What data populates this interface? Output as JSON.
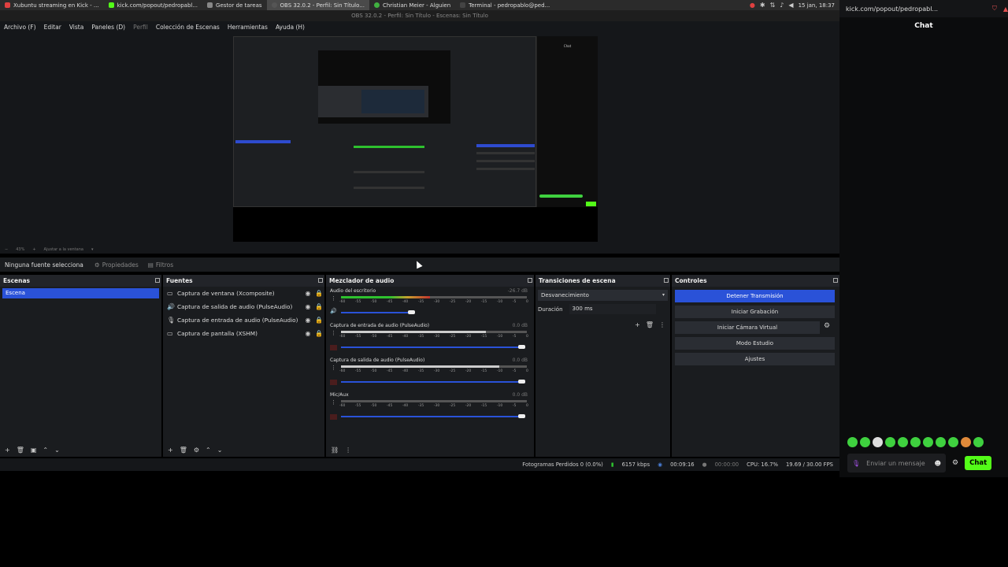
{
  "topbar": {
    "tabs": [
      {
        "label": "Xubuntu streaming en Kick - ...",
        "color": "#e04040"
      },
      {
        "label": "kick.com/popout/pedropabl...",
        "color": "#53fc18"
      },
      {
        "label": "Gestor de tareas",
        "color": "#888888"
      },
      {
        "label": "OBS 32.0.2 - Perfil: Sin Título...",
        "color": "#555555"
      },
      {
        "label": "Christian Meier - Alguien",
        "color": "#40b040"
      },
      {
        "label": "Terminal - pedropablo@ped...",
        "color": "#444444"
      }
    ],
    "clock": "15 jan, 18:37"
  },
  "obs": {
    "window_title": "OBS 32.0.2 - Perfil: Sin Título - Escenas: Sin Título",
    "menu": [
      "Archivo (F)",
      "Editar",
      "Vista",
      "Paneles (D)",
      "Perfil",
      "Colección de Escenas",
      "Herramientas",
      "Ayuda (H)"
    ],
    "zoom": {
      "value": "43%",
      "fit": "Ajustar a la ventana"
    },
    "props": {
      "no_source": "Ninguna fuente selecciona",
      "properties": "Propiedades",
      "filters": "Filtros"
    },
    "scenes": {
      "title": "Escenas",
      "items": [
        "Escena"
      ]
    },
    "sources": {
      "title": "Fuentes",
      "items": [
        {
          "label": "Captura de ventana (Xcomposite)",
          "icon": "window-icon"
        },
        {
          "label": "Captura de salida de audio (PulseAudio)",
          "icon": "speaker-icon"
        },
        {
          "label": "Captura de entrada de audio (PulseAudio)",
          "icon": "mic-icon"
        },
        {
          "label": "Captura de pantalla (XSHM)",
          "icon": "monitor-icon"
        }
      ]
    },
    "mixer": {
      "title": "Mezclador de audio",
      "scale": [
        "-60",
        "-55",
        "-50",
        "-45",
        "-40",
        "-35",
        "-30",
        "-25",
        "-20",
        "-15",
        "-10",
        "-5",
        "0"
      ],
      "channels": [
        {
          "name": "Audio del escritorio",
          "db": "-26.7 dB",
          "level": 0.48,
          "volume": 0.4,
          "muted": false
        },
        {
          "name": "Captura de entrada de audio (PulseAudio)",
          "db": "0.0 dB",
          "level": 0.78,
          "volume": 1.0,
          "muted": true
        },
        {
          "name": "Captura de salida de audio (PulseAudio)",
          "db": "0.0 dB",
          "level": 0.85,
          "volume": 1.0,
          "muted": true
        },
        {
          "name": "Mic/Aux",
          "db": "0.0 dB",
          "level": 0.0,
          "volume": 1.0,
          "muted": true
        }
      ]
    },
    "transitions": {
      "title": "Transiciones de escena",
      "selected": "Desvanecimiento",
      "duration_label": "Duración",
      "duration": "300 ms"
    },
    "controls": {
      "title": "Controles",
      "stop_stream": "Detener Transmisión",
      "start_record": "Iniciar Grabación",
      "virtual_cam": "Iniciar Cámara Virtual",
      "studio": "Modo Estudio",
      "settings": "Ajustes"
    },
    "status": {
      "dropped": "Fotogramas Perdidos 0 (0.0%)",
      "bitrate": "6157 kbps",
      "stream_time": "00:09:16",
      "rec_time": "00:00:00",
      "cpu": "CPU: 16.7%",
      "fps": "19.69 / 30.00 FPS"
    },
    "preview_chat_label": "Chat"
  },
  "chat": {
    "url": "kick.com/popout/pedropabl...",
    "title": "Chat",
    "placeholder": "Enviar un mensaje",
    "send": "Chat",
    "accent": "#53fc18"
  }
}
